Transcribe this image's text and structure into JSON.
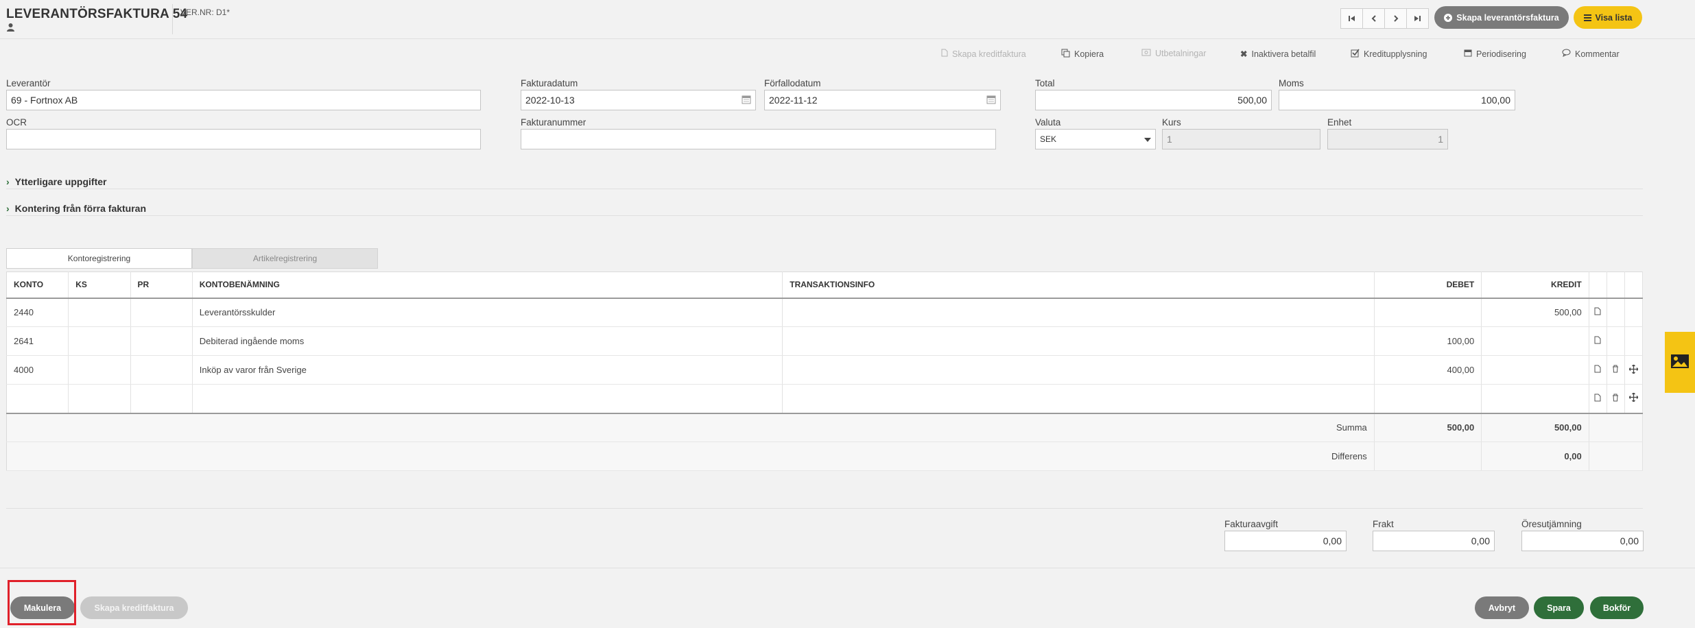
{
  "header": {
    "title": "LEVERANTÖRSFAKTURA 54",
    "ver": "VER.NR: D1*",
    "create_button": "Skapa leverantörsfaktura",
    "list_button": "Visa lista"
  },
  "toolbar": {
    "credit": "Skapa kreditfaktura",
    "copy": "Kopiera",
    "payments": "Utbetalningar",
    "inactivate": "Inaktivera betalfil",
    "credit_info": "Kreditupplysning",
    "periodize": "Periodisering",
    "comment": "Kommentar"
  },
  "form": {
    "supplier_label": "Leverantör",
    "supplier_value": "69 - Fortnox AB",
    "ocr_label": "OCR",
    "ocr_value": "",
    "invoice_date_label": "Fakturadatum",
    "invoice_date_value": "2022-10-13",
    "due_date_label": "Förfallodatum",
    "due_date_value": "2022-11-12",
    "invoice_number_label": "Fakturanummer",
    "invoice_number_value": "",
    "total_label": "Total",
    "total_value": "500,00",
    "vat_label": "Moms",
    "vat_value": "100,00",
    "currency_label": "Valuta",
    "currency_value": "SEK",
    "rate_label": "Kurs",
    "rate_value": "1",
    "unit_label": "Enhet",
    "unit_value": "1"
  },
  "sections": {
    "more_info": "Ytterligare uppgifter",
    "prev_booking": "Kontering från förra fakturan"
  },
  "tabs": {
    "account": "Kontoregistrering",
    "article": "Artikelregistrering"
  },
  "table": {
    "headers": {
      "account": "KONTO",
      "ks": "KS",
      "pr": "PR",
      "name": "KONTOBENÄMNING",
      "info": "TRANSAKTIONSINFO",
      "debit": "DEBET",
      "credit": "KREDIT"
    },
    "rows": [
      {
        "account": "2440",
        "name": "Leverantörsskulder",
        "debit": "",
        "credit": "500,00"
      },
      {
        "account": "2641",
        "name": "Debiterad ingående moms",
        "debit": "100,00",
        "credit": ""
      },
      {
        "account": "4000",
        "name": "Inköp av varor från Sverige",
        "debit": "400,00",
        "credit": ""
      },
      {
        "account": "",
        "name": "",
        "debit": "",
        "credit": ""
      }
    ],
    "sum_label": "Summa",
    "sum_debit": "500,00",
    "sum_credit": "500,00",
    "diff_label": "Differens",
    "diff_value": "0,00"
  },
  "fees": {
    "invoice_fee_label": "Fakturaavgift",
    "invoice_fee_value": "0,00",
    "freight_label": "Frakt",
    "freight_value": "0,00",
    "rounding_label": "Öresutjämning",
    "rounding_value": "0,00"
  },
  "footer": {
    "void": "Makulera",
    "credit": "Skapa kreditfaktura",
    "cancel": "Avbryt",
    "save": "Spara",
    "book": "Bokför"
  },
  "colors": {
    "accent_yellow": "#f4c414",
    "green": "#2f6f3a",
    "highlight_red": "#e0202a"
  }
}
